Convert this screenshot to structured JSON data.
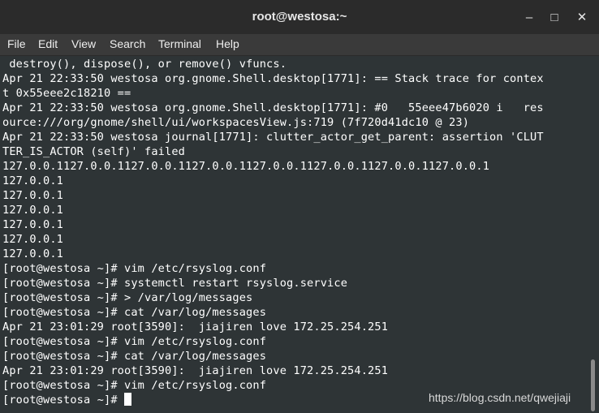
{
  "window": {
    "title": "root@westosa:~",
    "minimize_glyph": "–",
    "maximize_glyph": "□",
    "close_glyph": "✕"
  },
  "menu": [
    "File",
    "Edit",
    "View",
    "Search",
    "Terminal",
    "Help"
  ],
  "terminal": {
    "lines": [
      " destroy(), dispose(), or remove() vfuncs.",
      "Apr 21 22:33:50 westosa org.gnome.Shell.desktop[1771]: == Stack trace for contex",
      "t 0x55eee2c18210 ==",
      "Apr 21 22:33:50 westosa org.gnome.Shell.desktop[1771]: #0   55eee47b6020 i   res",
      "ource:///org/gnome/shell/ui/workspacesView.js:719 (7f720d41dc10 @ 23)",
      "Apr 21 22:33:50 westosa journal[1771]: clutter_actor_get_parent: assertion 'CLUT",
      "TER_IS_ACTOR (self)' failed",
      "127.0.0.1127.0.0.1127.0.0.1127.0.0.1127.0.0.1127.0.0.1127.0.0.1127.0.0.1",
      "127.0.0.1",
      "127.0.0.1",
      "127.0.0.1",
      "127.0.0.1",
      "127.0.0.1",
      "127.0.0.1",
      "[root@westosa ~]# vim /etc/rsyslog.conf",
      "[root@westosa ~]# systemctl restart rsyslog.service",
      "[root@westosa ~]# > /var/log/messages",
      "[root@westosa ~]# cat /var/log/messages",
      "Apr 21 23:01:29 root[3590]:  jiajiren love 172.25.254.251",
      "[root@westosa ~]# vim /etc/rsyslog.conf",
      "[root@westosa ~]# cat /var/log/messages",
      "Apr 21 23:01:29 root[3590]:  jiajiren love 172.25.254.251",
      "[root@westosa ~]# vim /etc/rsyslog.conf"
    ],
    "prompt": "[root@westosa ~]# "
  },
  "watermark": "https://blog.csdn.net/qwejiaji",
  "colors": {
    "background": "#2e3436",
    "titlebar": "#2b2b2b",
    "menubar": "#3a3a3a",
    "text": "#ffffff"
  }
}
